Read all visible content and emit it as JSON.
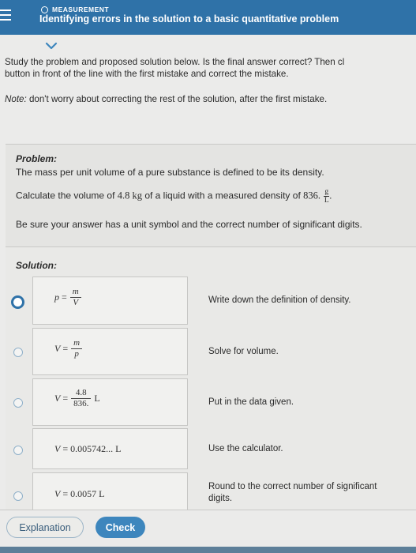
{
  "header": {
    "topic": "MEASUREMENT",
    "title": "Identifying errors in the solution to a basic quantitative problem"
  },
  "instructions": {
    "line1": "Study the problem and proposed solution below. Is the final answer correct? Then cl",
    "line2": "button in front of the line with the first mistake and correct the mistake.",
    "note_label": "Note:",
    "note_text": " don't worry about correcting the rest of the solution, after the first mistake."
  },
  "problem": {
    "heading": "Problem:",
    "line1": "The mass per unit volume of a pure substance is defined to be its density.",
    "line2_prefix": "Calculate the volume of ",
    "mass_value": "4.8 kg",
    "line2_mid": " of a liquid with a measured density of ",
    "density_value": "836.",
    "density_unit_num": "g",
    "density_unit_den": "L",
    "line2_suffix": ".",
    "hint": "Be sure your answer has a unit symbol and the correct number of significant digits."
  },
  "solution": {
    "heading": "Solution:",
    "steps": [
      {
        "lhs": "p",
        "equals": "=",
        "frac_num": "m",
        "frac_den": "V",
        "comment": "Write down the definition of density.",
        "selected": true
      },
      {
        "lhs": "V",
        "equals": "=",
        "frac_num": "m",
        "frac_den": "p",
        "comment": "Solve for volume.",
        "selected": false
      },
      {
        "lhs": "V",
        "equals": "=",
        "frac_num": "4.8",
        "frac_den": "836.",
        "unit": "L",
        "comment": "Put in the data given.",
        "selected": false
      },
      {
        "lhs": "V",
        "equals": "=",
        "value": "0.005742... L",
        "comment": "Use the calculator.",
        "selected": false
      },
      {
        "lhs": "V",
        "equals": "=",
        "value": "0.0057 L",
        "comment_line1": "Round to the correct number of significant",
        "comment_line2": "digits.",
        "selected": false
      }
    ]
  },
  "footer": {
    "explanation_label": "Explanation",
    "check_label": "Check"
  },
  "colors": {
    "header_bg": "#2f72a8",
    "check_bg": "#3d86bd",
    "radio_selected": "#2f72a8"
  }
}
